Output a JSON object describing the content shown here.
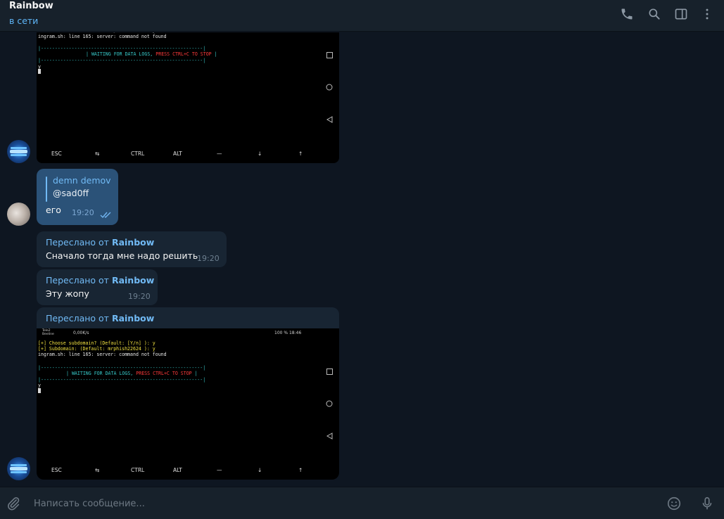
{
  "header": {
    "title": "Rainbow",
    "status": "в сети",
    "icons": [
      "phone-icon",
      "search-icon",
      "sidebar-toggle-icon",
      "more-vertical-icon"
    ]
  },
  "terminal": {
    "status_left": "Tele2 Beeline",
    "status_speed": "0,00K/s",
    "status_right": "100 %  18:46",
    "line1_prefix": "[+] ",
    "line1_text": "Choose subdomain? (Default: [Y/n] ): y",
    "line2_prefix": "[+] ",
    "line2_text": "Subdomain: (Default: mrphish22624 ): y",
    "line3": "ingram.sh: line 165: server: command not found",
    "dashes": "|----------------------------------------------------------|",
    "waiting_text": "| WAITING FOR DATA LOGS, ",
    "press_text": "PRESS CTRL+C TO STOP",
    "waiting_end": " |",
    "input_line": "y",
    "keys": [
      "ESC",
      "⇆",
      "CTRL",
      "ALT",
      "—",
      "↓",
      "↑"
    ]
  },
  "messages": [
    {
      "type": "photo",
      "sender": "Rainbow"
    },
    {
      "type": "text",
      "outgoing": true,
      "reply_name": "demn demov",
      "reply_text": "@sad0ff",
      "text": "его",
      "time": "19:20",
      "read": true
    },
    {
      "type": "forwarded",
      "forward_prefix": "Переслано от",
      "forward_from": "Rainbow",
      "text": "Сначало тогда мне надо решить",
      "time": "19:20"
    },
    {
      "type": "forwarded",
      "forward_prefix": "Переслано от",
      "forward_from": "Rainbow",
      "text": "Эту жопу",
      "time": "19:20"
    },
    {
      "type": "forwarded-photo",
      "forward_prefix": "Переслано от",
      "forward_from": "Rainbow"
    }
  ],
  "composer": {
    "placeholder": "Написать сообщение..."
  },
  "colors": {
    "background": "#0e1621",
    "panel": "#17212b",
    "incoming_bubble": "#182533",
    "outgoing_bubble": "#2b5278",
    "accent": "#71baf5"
  }
}
